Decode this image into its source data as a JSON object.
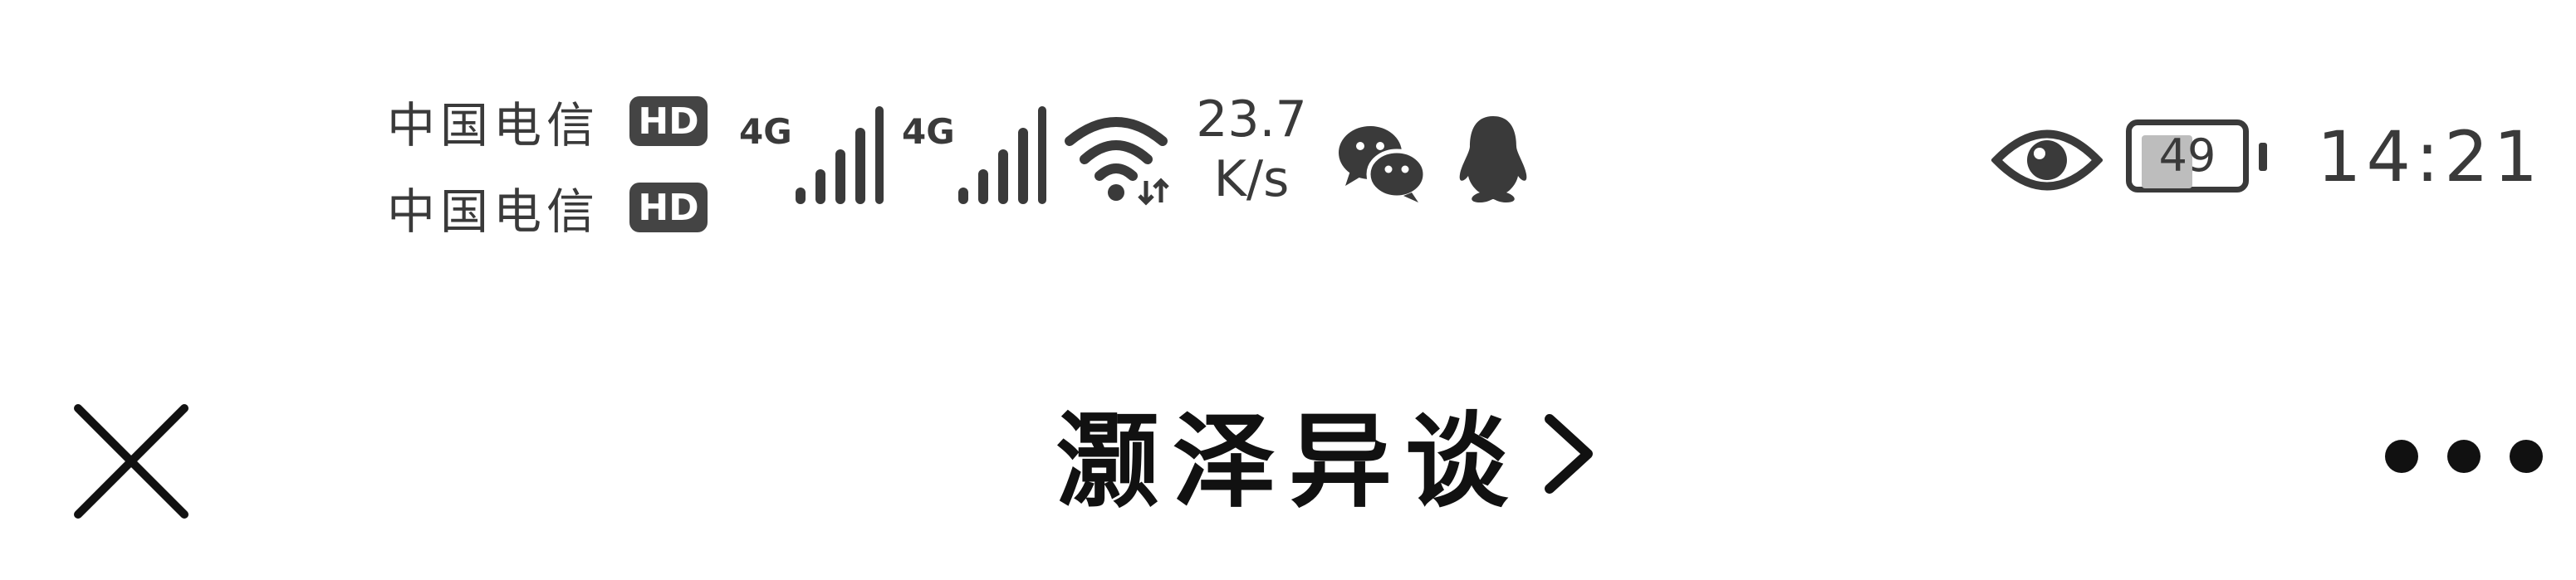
{
  "status_bar": {
    "carriers": [
      {
        "name": "中国电信",
        "badge": "HD"
      },
      {
        "name": "中国电信",
        "badge": "HD"
      }
    ],
    "signals": [
      {
        "network": "4G",
        "level": 1.0
      },
      {
        "network": "4G",
        "level": 1.0
      }
    ],
    "net_speed": {
      "value": "23.7",
      "unit": "K/s"
    },
    "notification_icons": [
      "wechat-icon",
      "qq-icon"
    ],
    "battery_level": "49",
    "battery_fraction": 0.49,
    "time": "14:21"
  },
  "nav_bar": {
    "title": "灏泽异谈",
    "close_icon": "close-icon",
    "chevron_icon": "chevron-right-icon",
    "more_icon": "more-icon"
  },
  "colors": {
    "status_icon": "#3a3a3a",
    "title": "#111111",
    "background": "#ffffff",
    "battery_fill": "#bdbdbd"
  }
}
